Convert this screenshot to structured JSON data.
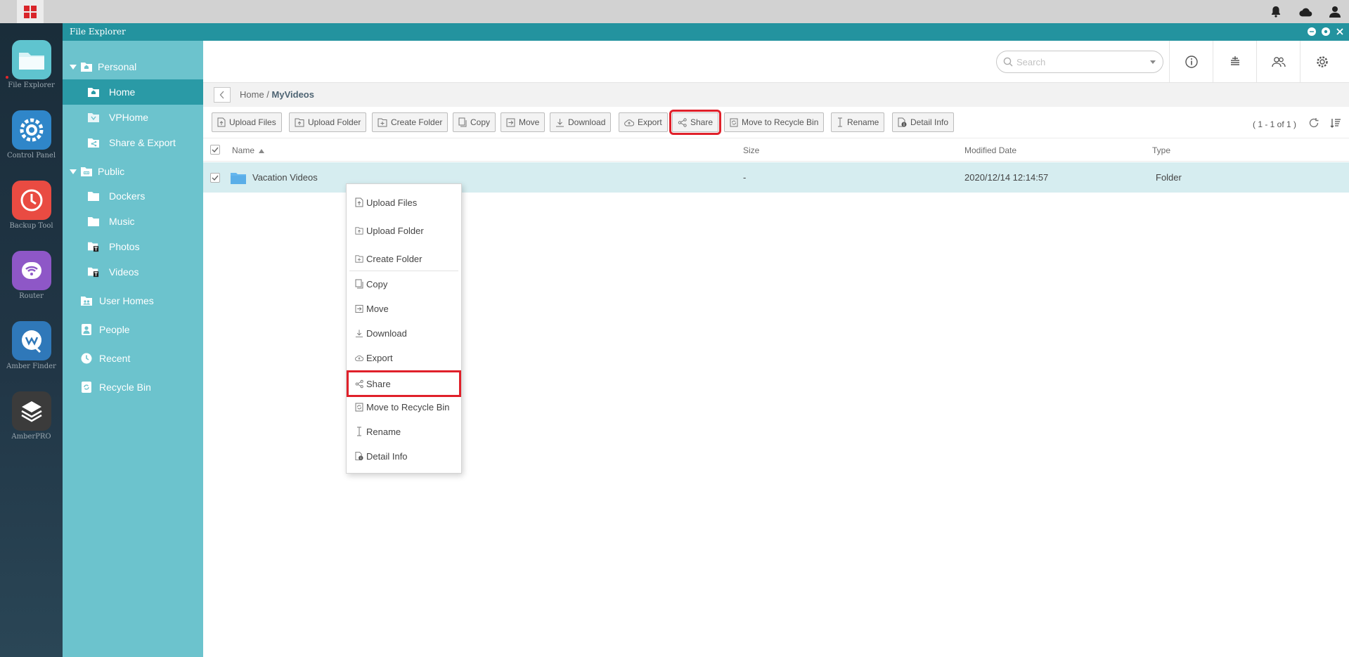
{
  "window": {
    "title": "File Explorer"
  },
  "dock": {
    "apps": [
      {
        "label": "File Explorer",
        "icon": "folder-icon",
        "color": "#5fc4cf"
      },
      {
        "label": "Control Panel",
        "icon": "gear-icon",
        "color": "#2f86c9"
      },
      {
        "label": "Backup Tool",
        "icon": "clock-icon",
        "color": "#e94b42"
      },
      {
        "label": "Router",
        "icon": "wifi-icon",
        "color": "#8e57c7"
      },
      {
        "label": "Amber Finder",
        "icon": "amber-finder-icon",
        "color": "#2f78b9"
      },
      {
        "label": "AmberPRO",
        "icon": "amberpro-icon",
        "color": "#3b3b3b"
      }
    ]
  },
  "sidebar": {
    "personal": "Personal",
    "home": "Home",
    "vphome": "VPHome",
    "share_export": "Share & Export",
    "public": "Public",
    "dockers": "Dockers",
    "music": "Music",
    "photos": "Photos",
    "videos": "Videos",
    "user_homes": "User Homes",
    "people": "People",
    "recent": "Recent",
    "recycle_bin": "Recycle Bin"
  },
  "search": {
    "placeholder": "Search"
  },
  "breadcrumb": {
    "parent": "Home",
    "separator": " / ",
    "current": "MyVideos"
  },
  "toolbar": {
    "upload_files": "Upload Files",
    "upload_folder": "Upload Folder",
    "create_folder": "Create Folder",
    "copy": "Copy",
    "move": "Move",
    "download": "Download",
    "export": "Export",
    "share": "Share",
    "move_to_recycle_bin": "Move to Recycle Bin",
    "rename": "Rename",
    "detail_info": "Detail Info",
    "page_info": "( 1 - 1 of 1 )"
  },
  "table": {
    "columns": {
      "name": "Name",
      "size": "Size",
      "modified": "Modified Date",
      "type": "Type"
    },
    "rows": [
      {
        "name": "Vacation Videos",
        "size": "-",
        "modified": "2020/12/14 12:14:57",
        "type": "Folder"
      }
    ]
  },
  "context_menu": {
    "items": [
      "Upload Files",
      "Upload Folder",
      "Create Folder",
      "Copy",
      "Move",
      "Download",
      "Export",
      "Share",
      "Move to Recycle Bin",
      "Rename",
      "Detail Info"
    ]
  },
  "colors": {
    "titlebar": "#23939f",
    "sidebar": "#6cc3cd",
    "sidebar_active": "#2a9aa6",
    "selected_row": "#d6edf0",
    "highlight": "#e0202a"
  }
}
